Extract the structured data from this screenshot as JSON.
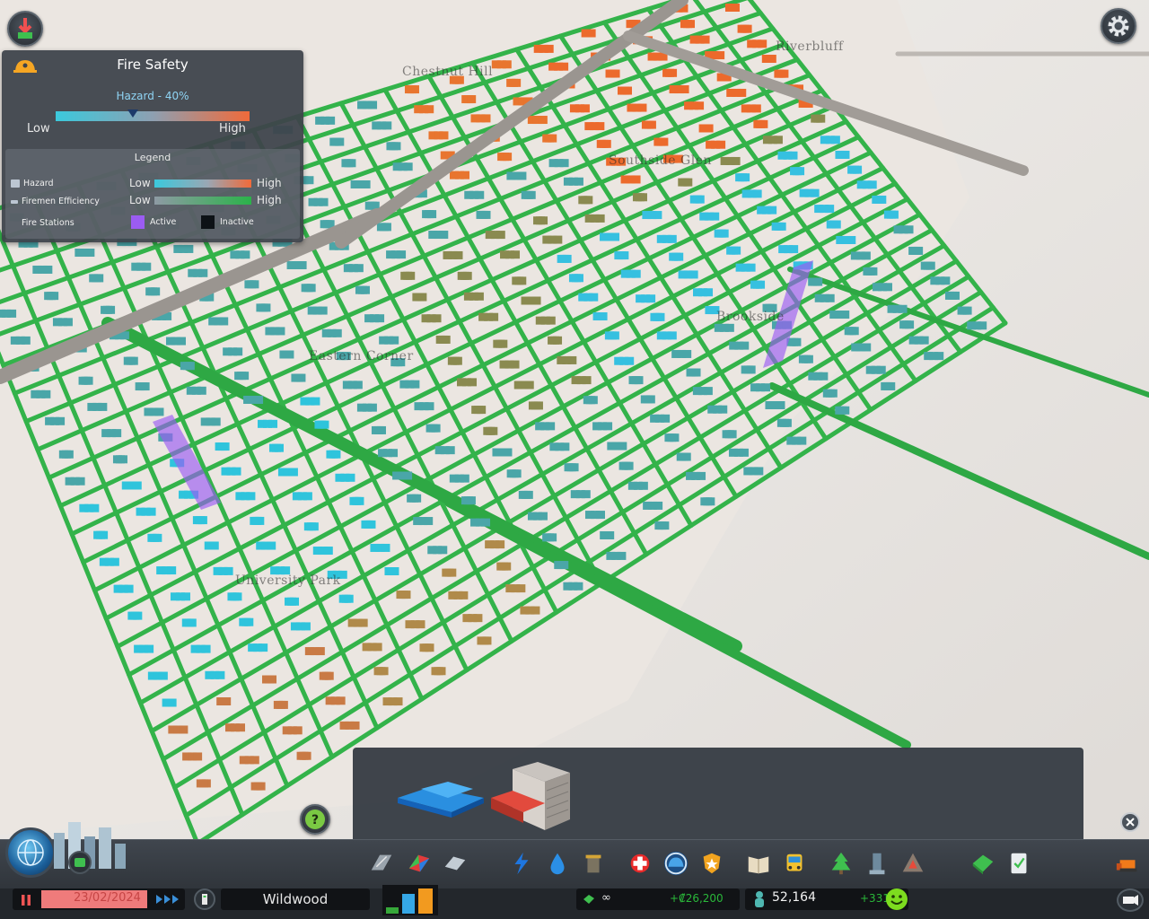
{
  "map": {
    "districts": [
      {
        "name": "Chestnut Hill"
      },
      {
        "name": "Riverbluff"
      },
      {
        "name": "Southside Glen"
      },
      {
        "name": "Brookside"
      },
      {
        "name": "Eastern Corner"
      },
      {
        "name": "University Park"
      }
    ]
  },
  "info_panel": {
    "title": "Fire Safety",
    "icon": "fire-helmet-icon",
    "hazard_label": "Hazard - 40%",
    "hazard_level": 0.4,
    "scale_low": "Low",
    "scale_high": "High",
    "legend": {
      "title": "Legend",
      "hazard_label": "Hazard",
      "hazard_low": "Low",
      "hazard_high": "High",
      "firemen_label": "Firemen Efficiency",
      "firemen_low": "Low",
      "firemen_high": "High",
      "stations_label": "Fire Stations",
      "active_label": "Active",
      "inactive_label": "Inactive",
      "active_color": "#9b5cf2",
      "inactive_color": "#0d1216"
    }
  },
  "colors": {
    "hazard_low": "#3bc9dc",
    "hazard_high": "#f06a3a",
    "efficiency_low": "#8e9aa4",
    "efficiency_high": "#2bb34a",
    "road_covered": "#33b34a"
  },
  "top_buttons": {
    "left_icon": "unlock-milestone-icon",
    "right_icon": "settings-gear-icon"
  },
  "preview": {
    "items": [
      {
        "icon": "fire-station-building-icon"
      },
      {
        "icon": "fire-house-building-icon"
      }
    ]
  },
  "toolbar": {
    "tools": [
      {
        "icon": "roads-icon"
      },
      {
        "icon": "zoning-icon"
      },
      {
        "icon": "districts-icon"
      },
      {
        "icon": "electricity-icon"
      },
      {
        "icon": "water-icon"
      },
      {
        "icon": "garbage-icon"
      },
      {
        "icon": "healthcare-icon"
      },
      {
        "icon": "fire-department-icon"
      },
      {
        "icon": "police-icon"
      },
      {
        "icon": "education-icon"
      },
      {
        "icon": "public-transport-icon"
      },
      {
        "icon": "beautification-icon"
      },
      {
        "icon": "monuments-icon"
      },
      {
        "icon": "wonders-icon"
      },
      {
        "icon": "economy-icon"
      },
      {
        "icon": "policies-icon"
      },
      {
        "icon": "bulldozer-icon"
      }
    ]
  },
  "status": {
    "date": "23/02/2024",
    "city_name": "Wildwood",
    "money": "∞",
    "income": "+₡26,200",
    "population": "52,164",
    "population_delta": "+331",
    "demand": {
      "residential": 0.25,
      "commercial": 0.75,
      "industrial": 0.95
    }
  }
}
